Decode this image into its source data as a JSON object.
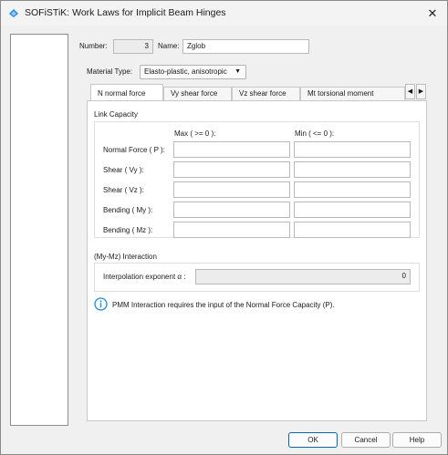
{
  "window": {
    "title": "SOFiSTiK: Work Laws for Implicit Beam Hinges",
    "close_symbol": "✕",
    "accent_color": "#1e88e5"
  },
  "header": {
    "number_label": "Number:",
    "number_value": "3",
    "name_label": "Name:",
    "name_value": "Zglob"
  },
  "material": {
    "label": "Material Type:",
    "selected": "Elasto-plastic, anisotropic",
    "arrow": "▼"
  },
  "tabs": [
    {
      "label": "N   normal force",
      "active": true
    },
    {
      "label": "Vy  shear force",
      "active": false
    },
    {
      "label": "Vz  shear force",
      "active": false
    },
    {
      "label": "Mt  torsional moment",
      "active": false
    }
  ],
  "tab_scroll": {
    "left": "◀",
    "right": "▶"
  },
  "link_capacity": {
    "title": "Link Capacity",
    "max_header": "Max ( >= 0 ):",
    "min_header": "Min ( <= 0 ):",
    "rows": [
      {
        "label": "Normal Force ( P ):",
        "max": "",
        "min": ""
      },
      {
        "label": "Shear ( Vy ):",
        "max": "",
        "min": ""
      },
      {
        "label": "Shear ( Vz ):",
        "max": "",
        "min": ""
      },
      {
        "label": "Bending ( My ):",
        "max": "",
        "min": ""
      },
      {
        "label": "Bending ( Mz ):",
        "max": "",
        "min": ""
      }
    ]
  },
  "interaction": {
    "title": "(My-Mz) Interaction",
    "exponent_label": "Interpolation exponent α :",
    "exponent_value": "0"
  },
  "info": {
    "icon": "info-icon",
    "message": "PMM Interaction requires the input of the Normal Force Capacity (P)."
  },
  "buttons": {
    "ok": "OK",
    "cancel": "Cancel",
    "help": "Help"
  }
}
